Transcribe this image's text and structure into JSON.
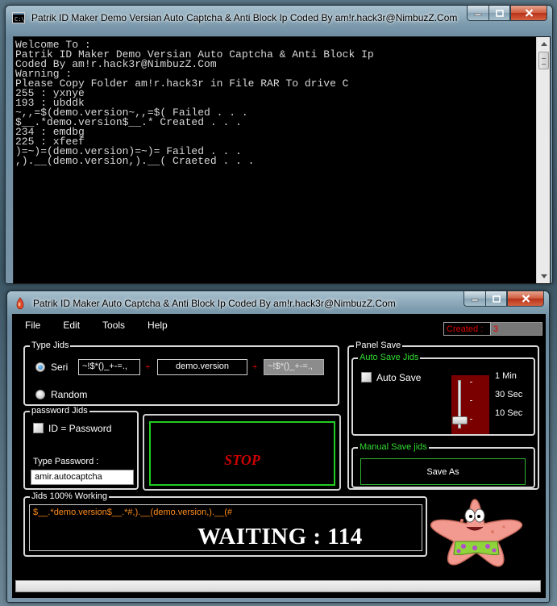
{
  "console_window": {
    "title": "Patrik ID Maker Demo Versian Auto Captcha & Anti Block Ip Coded By am!r.hack3r@NimbuzZ.Com",
    "lines": [
      "Welcome To :",
      "Patrik ID Maker Demo Versian Auto Captcha & Anti Block Ip",
      "Coded By am!r.hack3r@NimbuzZ.Com",
      "Warning :",
      "Please Copy Folder am!r.hack3r in File RAR To drive C",
      "255 : yxnye",
      "193 : ubddk",
      "~,,=$(demo.version~,,=$( Failed . . .",
      "$__.*demo.version$__.* Created . . .",
      "234 : emdbg",
      "225 : xfeef",
      ")=~)=(demo.version)=~)= Failed . . .",
      ",).__(demo.version,).__( Craeted . . ."
    ]
  },
  "app_window": {
    "title": "Patrik ID Maker Auto Captcha & Anti Block Ip  Coded By am!r.hack3r@NimbuzZ.Com",
    "menu": [
      "File",
      "Edit",
      "Tools",
      "Help"
    ],
    "created_label": "Created :",
    "created_value": "3",
    "type_jids": {
      "group_label": "Type Jids",
      "option_seri": "Seri",
      "option_random": "Random",
      "prefix_value": "~!$*()_+-=.,",
      "base_value": "demo.version",
      "suffix_value": "~!$*()_+-=.,",
      "plus": "+"
    },
    "password_jids": {
      "group_label": "password Jids",
      "checkbox_label": "ID = Password",
      "type_password_label": "Type Password :",
      "password_value": "amir.autocaptcha"
    },
    "stop_label": "STOP",
    "panel_save": {
      "group_label": "Panel Save",
      "auto_save_group_label": "Auto Save Jids",
      "auto_save_checkbox": "Auto Save",
      "interval_options": [
        "1 Min",
        "30 Sec",
        "10 Sec"
      ],
      "manual_save_group_label": "Manual Save jids",
      "save_as_label": "Save As"
    },
    "jids_working": {
      "group_label": "Jids 100% Working",
      "text": "$__.*demo.version$__.*#,).__(demo.version,).__(#",
      "status": "WAITING : 114"
    }
  },
  "colors": {
    "console_bg": "#000000",
    "console_text": "#d8d8d8",
    "accent_green": "#22cc22",
    "stop_red": "#cc0000",
    "created_red": "#e00000",
    "jids_orange": "#ff8c1a",
    "slider_bg": "#7a0000"
  }
}
